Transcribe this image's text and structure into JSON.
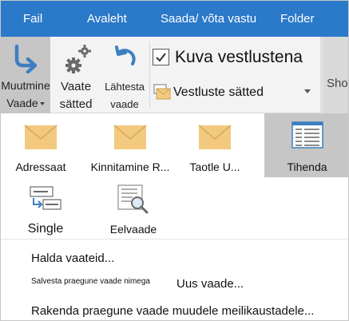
{
  "tabs": [
    "Fail",
    "Avaleht",
    "Saada/ võta vastu",
    "Folder"
  ],
  "ribbon": {
    "change_view": {
      "line1": "Muutmine",
      "line2": "Vaade"
    },
    "view_settings": {
      "line1": "Vaate",
      "line2": "sätted"
    },
    "reset_view": {
      "line1": "Lähtesta",
      "line2": "vaade"
    },
    "show_as_conversations": {
      "label": "Kuva vestlustena",
      "checked": true
    },
    "conversation_settings": {
      "label": "Vestluste sätted"
    },
    "show_partial": "Sho"
  },
  "gallery": [
    {
      "label": "Adressaat",
      "icon": "envelope-icon"
    },
    {
      "label": "Kinnitamine R...",
      "icon": "envelope-icon"
    },
    {
      "label": "Taotle U...",
      "icon": "envelope-icon"
    },
    {
      "label": "Tihenda",
      "icon": "compact-list-icon",
      "selected": true
    },
    {
      "label": "Single",
      "icon": "single-view-icon"
    },
    {
      "label": "Eelvaade",
      "icon": "preview-magnifier-icon"
    }
  ],
  "menu": {
    "manage_views": "Halda vaateid...",
    "save_current_view_as": "Salvesta praegune vaade nimega",
    "new_view": "Uus vaade...",
    "apply_current_view": "Rakenda praegune vaade muudele meilikaustadele..."
  },
  "colors": {
    "tab_bar": "#2b79c9",
    "ribbon_bg": "#f3f3f3",
    "selected_bg": "#c6c6c6",
    "envelope": "#f2c97e",
    "icon_blue": "#3c7fc1",
    "icon_gray": "#6a6a6a"
  }
}
